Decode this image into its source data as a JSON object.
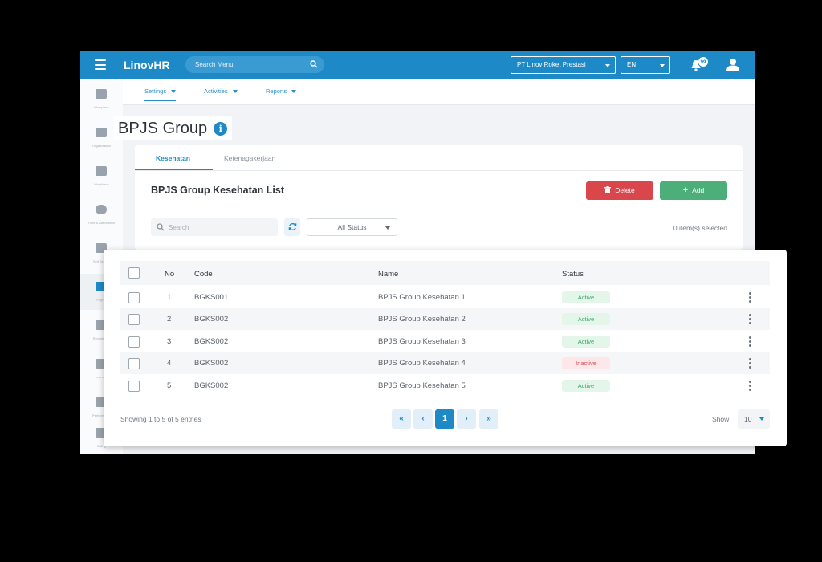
{
  "app": {
    "logo": "LinovHR"
  },
  "topbar": {
    "search_placeholder": "Search Menu",
    "company": "PT Linov Roket Prestasi",
    "language": "EN",
    "notification_count": "99"
  },
  "sidebar": {
    "items": [
      {
        "label": "Workplace",
        "icon": "briefcase-icon"
      },
      {
        "label": "Organization",
        "icon": "org-chart-icon"
      },
      {
        "label": "Workforce",
        "icon": "people-icon"
      },
      {
        "label": "Time & Attendance",
        "icon": "clock-icon"
      },
      {
        "label": "Self Service",
        "icon": "self-service-icon"
      },
      {
        "label": "Payroll",
        "icon": "payroll-icon"
      },
      {
        "label": "Recruitment",
        "icon": "person-icon"
      },
      {
        "label": "Learning",
        "icon": "bar-chart-icon"
      },
      {
        "label": "Performance",
        "icon": "line-chart-icon"
      },
      {
        "label": "Billing",
        "icon": "card-icon"
      }
    ]
  },
  "subnav": {
    "settings": "Settings",
    "activities": "Activities",
    "reports": "Reports"
  },
  "page": {
    "title": "BPJS Group"
  },
  "tabs": {
    "kesehatan": "Kesehatan",
    "ketenagakerjaan": "Ketenagakerjaan"
  },
  "list": {
    "title": "BPJS Group Kesehatan List",
    "delete_label": "Delete",
    "add_label": "Add",
    "search_placeholder": "Search",
    "status_filter": "All Status",
    "selected_count": "0 item(s) selected"
  },
  "table": {
    "headers": {
      "no": "No",
      "code": "Code",
      "name": "Name",
      "status": "Status"
    },
    "rows": [
      {
        "no": "1",
        "code": "BGKS001",
        "name": "BPJS Group Kesehatan 1",
        "status": "Active"
      },
      {
        "no": "2",
        "code": "BGKS002",
        "name": "BPJS Group Kesehatan 2",
        "status": "Active"
      },
      {
        "no": "3",
        "code": "BGKS002",
        "name": "BPJS Group Kesehatan 3",
        "status": "Active"
      },
      {
        "no": "4",
        "code": "BGKS002",
        "name": "BPJS Group Kesehatan 4",
        "status": "Inactive"
      },
      {
        "no": "5",
        "code": "BGKS002",
        "name": "BPJS Group Kesehatan 5",
        "status": "Active"
      }
    ]
  },
  "pagination": {
    "showing": "Showing 1 to 5 of 5 entries",
    "first": "«",
    "prev": "‹",
    "current": "1",
    "next": "›",
    "last": "»",
    "show_label": "Show",
    "page_size": "10"
  },
  "colors": {
    "primary": "#1d8ac7",
    "delete": "#d9464b",
    "add": "#4caf7a",
    "active": "#3da76a",
    "inactive": "#e04b55"
  }
}
